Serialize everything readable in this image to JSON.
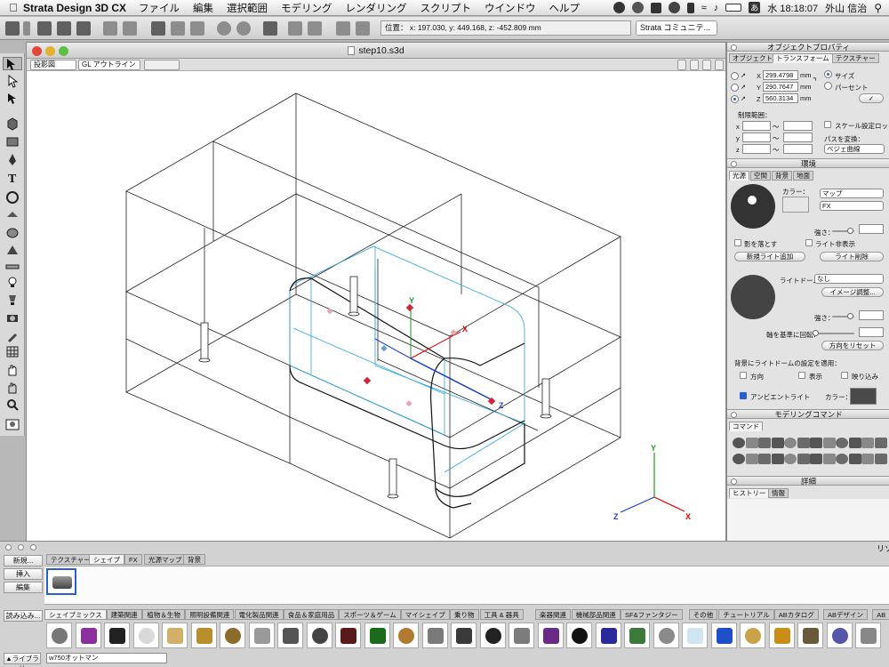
{
  "menubar": {
    "app": "Strata Design 3D CX",
    "items": [
      "ファイル",
      "編集",
      "選択範囲",
      "モデリング",
      "レンダリング",
      "スクリプト",
      "ウインドウ",
      "ヘルプ"
    ],
    "clock": "水 18:18:07",
    "user": "外山 信治",
    "ime": "あ"
  },
  "toolbar": {
    "coords": "位置： x: 197.030, y: 449.168, z: -452.809 mm",
    "community": "Strata コミュニテ..."
  },
  "document": {
    "title": "step10.s3d",
    "projection": "投影図",
    "render_mode": "GL アウトライン"
  },
  "object_panel": {
    "title": "オブジェクトプロパティ",
    "tabs": [
      "オブジェクト",
      "トランスフォーム",
      "テクスチャー"
    ],
    "axis_x": "X",
    "axis_y": "Y",
    "axis_z": "Z",
    "x": "299.4798",
    "y": "290.7647",
    "z": "560.3134",
    "unit": "mm",
    "size_label": "サイズ",
    "percent_label": "パーセント",
    "limits_label": "制限範囲：",
    "lx": "x",
    "ly": "y",
    "lz": "z",
    "tilde": "〜",
    "scale_lock": "スケール設定ロック",
    "path_label": "パスを変換：",
    "path_value": "ベジェ曲線"
  },
  "env_panel": {
    "title": "環境",
    "tabs": [
      "光源",
      "空間",
      "背景",
      "地面"
    ],
    "color_label": "カラー：",
    "map": "マップ",
    "fx": "FX",
    "strength": "強さ：",
    "shadow": "影を落とす",
    "light_hide": "ライト非表示",
    "new_light": "新規ライト追加",
    "delete_light": "ライト削除",
    "lightdome_label": "ライトドーム：",
    "lightdome_value": "なし",
    "image_adjust": "イメージ調整...",
    "strength2": "強さ：",
    "rotate_label": "軸を基準に回転：",
    "reset_dir": "方向をリセット",
    "apply_bg": "背景にライトドームの設定を適用：",
    "direction": "方向",
    "display": "表示",
    "reflection": "映り込み",
    "ambient": "アンビエントライト",
    "ambient_color": "カラー：",
    "ambient_swatch": "#4a4a4a"
  },
  "modeling_panel": {
    "title": "モデリングコマンド",
    "tab": "コマンド"
  },
  "detail_panel": {
    "title": "詳細",
    "tabs": [
      "ヒストリー",
      "情報"
    ]
  },
  "library": {
    "buttons": [
      "新規...",
      "挿入",
      "編集",
      "読み込み..."
    ],
    "top_tabs": [
      "テクスチャー",
      "シェイプ",
      "FX",
      "光源マップ",
      "背景"
    ],
    "categories": [
      "シェイプミックス",
      "建築関連",
      "植物＆生物",
      "照明設備関連",
      "電化製品関連",
      "食品＆家庭用品",
      "スポーツ＆ゲーム",
      "マイシェイプ",
      "乗り物",
      "工具 & 器具",
      "楽器関連",
      "機械部品関連",
      "SF&ファンタジー",
      "その他",
      "チュートリアル",
      "ABカタログ",
      "ABデザイン",
      "AB"
    ],
    "library_dd": "▲ライブラリ",
    "current": "w750オットマン",
    "right_label": "リソ"
  },
  "axes": {
    "x": "X",
    "y": "Y",
    "z": "Z"
  },
  "gizmo": {
    "x": "X",
    "y": "Y",
    "z": "Z"
  },
  "colors": {
    "accent": "#2a5fd1",
    "selection": "#2ba6e0",
    "axis_x": "#e00000",
    "axis_y": "#1a9e1a",
    "axis_z": "#1c3fd1",
    "handle": "#d0253a"
  }
}
